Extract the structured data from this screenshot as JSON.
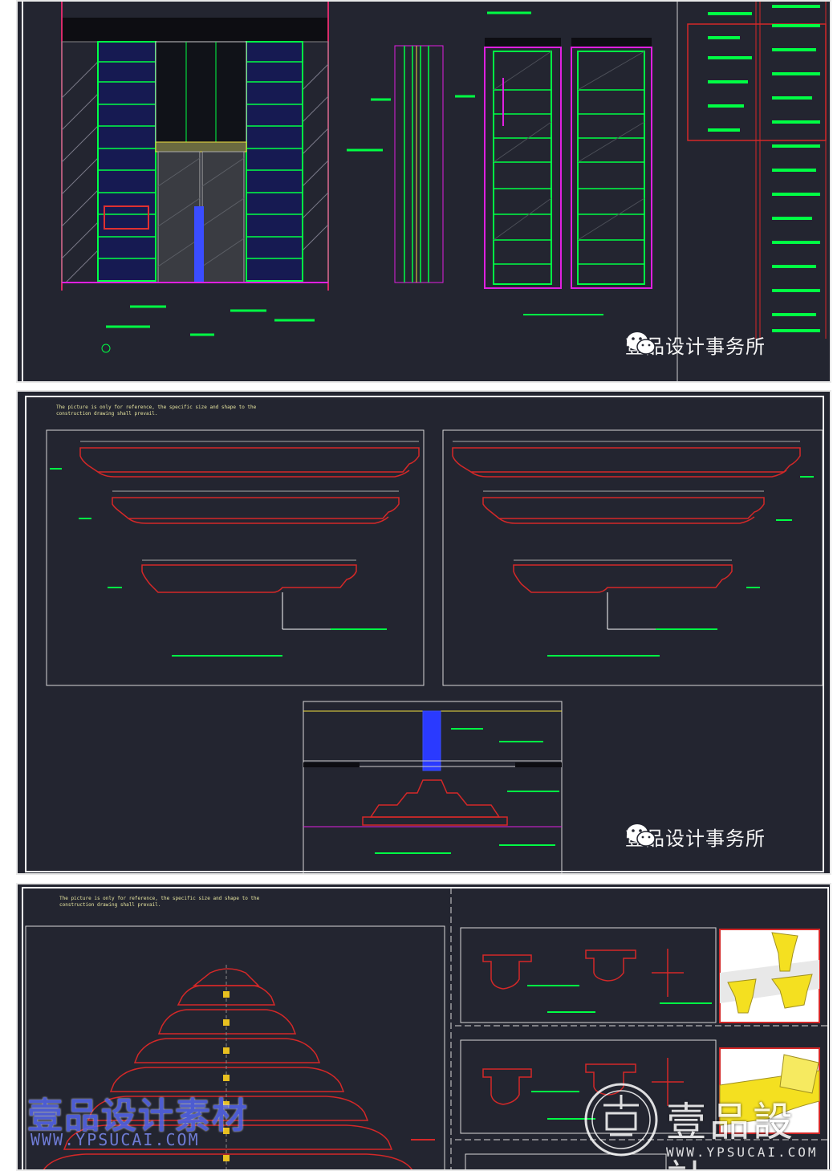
{
  "panels": [
    {
      "id": "elevation-sheet",
      "watermark": "壹品设计事务所"
    },
    {
      "id": "detail-sheet",
      "note": "The picture is only for reference, the specific size and shape to the\nconstruction drawing shall prevail.",
      "watermark": "壹品设计事务所"
    },
    {
      "id": "section-sheet",
      "note": "The picture is only for reference, the specific size and shape to the\nconstruction drawing shall prevail.",
      "watermark_cn": "壹品设计素材",
      "watermark_url": "WWW.YPSUCAI.COM",
      "brand_text": "壹品設計",
      "brand_url": "WWW.YPSUCAI.COM"
    }
  ],
  "colors": {
    "background": "#232530",
    "annotation": "#00ff44",
    "frame": "#ffffff",
    "detail_red": "#d42828",
    "magenta": "#e020e0",
    "blue": "#3a4dff",
    "yellow": "#f0e040"
  },
  "icons": [
    "wechat-icon",
    "brand-seal-icon"
  ]
}
